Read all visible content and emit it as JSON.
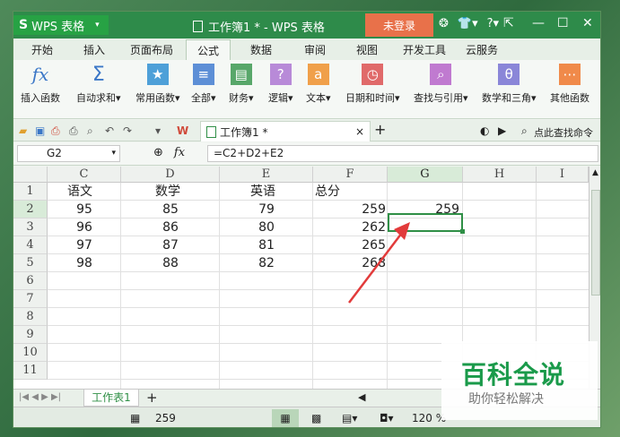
{
  "app": {
    "logo": "S",
    "name": "WPS 表格",
    "title": "工作簿1 * - WPS 表格",
    "login_label": "未登录"
  },
  "menu_tabs": [
    "开始",
    "插入",
    "页面布局",
    "公式",
    "数据",
    "审阅",
    "视图",
    "开发工具",
    "云服务"
  ],
  "active_tab": "公式",
  "ribbon": {
    "insert_function": "插入函数",
    "autosum": "自动求和",
    "common_functions": "常用函数",
    "all": "全部",
    "finance": "财务",
    "logic": "逻辑",
    "text": "文本",
    "datetime": "日期和时间",
    "lookup": "查找与引用",
    "math": "数学和三角",
    "other": "其他函数"
  },
  "file_tab": "工作簿1 *",
  "search_cmd": "点此查找命令",
  "name_box": "G2",
  "formula": "=C2+D2+E2",
  "columns": [
    "C",
    "D",
    "E",
    "F",
    "G",
    "H",
    "I"
  ],
  "rows": [
    "1",
    "2",
    "3",
    "4",
    "5",
    "6",
    "7",
    "8",
    "9",
    "10",
    "11"
  ],
  "cells": {
    "r1": [
      "语文",
      "数学",
      "英语",
      "总分"
    ],
    "r2": [
      "95",
      "85",
      "79",
      "259",
      "259"
    ],
    "r3": [
      "96",
      "86",
      "80",
      "262"
    ],
    "r4": [
      "97",
      "87",
      "81",
      "265"
    ],
    "r5": [
      "98",
      "88",
      "82",
      "268"
    ]
  },
  "sheet_tab": "工作表1",
  "status_value": "259",
  "zoom": "120 %",
  "watermark": {
    "title": "百科全说",
    "subtitle": "助你轻松解决"
  },
  "colors": {
    "accent": "#2f8f46",
    "title_bg": "#2e8b4a",
    "login_bg": "#e8714a",
    "arrow": "#e23b3b"
  }
}
